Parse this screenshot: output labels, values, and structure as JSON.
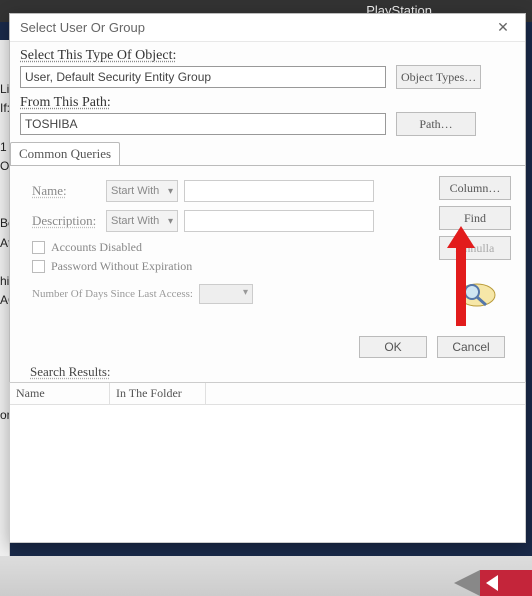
{
  "background": {
    "topbar_label": "PlayStation",
    "left_fragments": [
      "Lin",
      "If:",
      "1",
      "Of:",
      "Be",
      "At",
      "hi",
      "AC",
      "oni"
    ]
  },
  "dialog": {
    "title": "Select User Or Group",
    "close": "✕",
    "select_type_label": "Select This Type Of Object:",
    "object_value": "User, Default Security Entity Group",
    "object_types_btn": "Object Types…",
    "from_path_label": "From This Path:",
    "path_value": "TOSHIBA",
    "path_btn": "Path…",
    "tab": "Common Queries",
    "queries": {
      "name_label": "Name:",
      "name_combo": "Start With",
      "desc_label": "Description:",
      "desc_combo": "Start With",
      "acct_disabled": "Accounts Disabled",
      "pw_noexpire": "Password Without Expiration",
      "last_access": "Number Of Days Since Last Access:"
    },
    "side": {
      "columns": "Column…",
      "find": "Find",
      "abort": "Annulla"
    },
    "ok": "OK",
    "cancel": "Cancel",
    "search_results": "Search Results:",
    "columns": {
      "name": "Name",
      "folder": "In The Folder"
    }
  }
}
